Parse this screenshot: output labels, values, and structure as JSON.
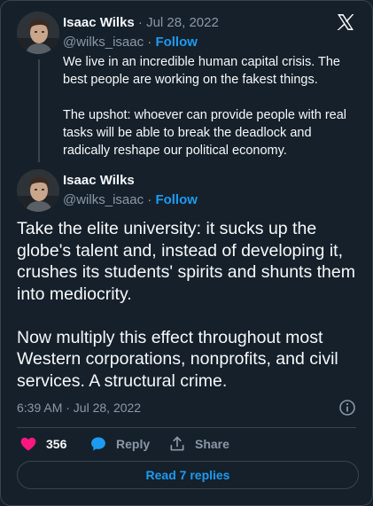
{
  "parent_tweet": {
    "author_name": "Isaac Wilks",
    "date_text": " · Jul 28, 2022",
    "handle": "@wilks_isaac",
    "separator": " · ",
    "follow_label": "Follow",
    "paragraphs": [
      "We live in an incredible human capital crisis. The best people are working on the fakest things.",
      "The upshot: whoever can provide people with real tasks will be able to break the deadlock and radically reshape our political economy."
    ]
  },
  "main_tweet": {
    "author_name": "Isaac Wilks",
    "handle": "@wilks_isaac",
    "separator": " · ",
    "follow_label": "Follow",
    "paragraphs": [
      "Take the elite university: it sucks up the globe's talent and, instead of developing it, crushes its students' spirits and shunts them into mediocrity.",
      "Now multiply this effect throughout most Western corporations, nonprofits, and civil services. A structural crime."
    ],
    "timestamp": "6:39 AM · Jul 28, 2022"
  },
  "actions": {
    "like_count": "356",
    "reply_label": "Reply",
    "share_label": "Share"
  },
  "read_replies_label": "Read 7 replies",
  "icons": {
    "logo": "x-logo-icon",
    "info": "info-icon",
    "like": "heart-icon",
    "reply": "speech-bubble-icon",
    "share": "share-icon"
  },
  "colors": {
    "background": "#15202b",
    "border": "#38444d",
    "text_primary": "#f7f9f9",
    "text_secondary": "#8b98a5",
    "accent": "#1d9bf0",
    "like": "#f91880"
  }
}
